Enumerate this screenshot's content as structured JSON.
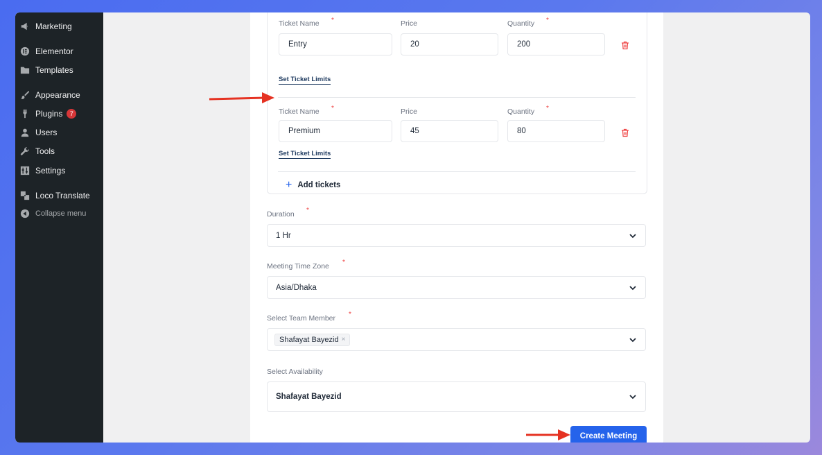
{
  "sidebar": {
    "items": [
      {
        "label": "Marketing",
        "icon": "megaphone-icon"
      },
      {
        "label": "Elementor",
        "icon": "elementor-icon"
      },
      {
        "label": "Templates",
        "icon": "folder-icon"
      },
      {
        "label": "Appearance",
        "icon": "paintbrush-icon"
      },
      {
        "label": "Plugins",
        "icon": "plugin-icon",
        "badge": "7"
      },
      {
        "label": "Users",
        "icon": "user-icon"
      },
      {
        "label": "Tools",
        "icon": "wrench-icon"
      },
      {
        "label": "Settings",
        "icon": "settings-icon"
      },
      {
        "label": "Loco Translate",
        "icon": "translate-icon"
      },
      {
        "label": "Collapse menu",
        "icon": "collapse-icon"
      }
    ]
  },
  "tickets": {
    "name_label": "Ticket Name",
    "price_label": "Price",
    "quantity_label": "Quantity",
    "required_mark": "*",
    "rows": [
      {
        "name": "Entry",
        "price": "20",
        "quantity": "200",
        "limits_link": "Set Ticket Limits"
      },
      {
        "name": "Premium",
        "price": "45",
        "quantity": "80",
        "limits_link": "Set Ticket Limits"
      }
    ],
    "add_label": "Add tickets"
  },
  "duration": {
    "label": "Duration",
    "value": "1 Hr"
  },
  "timezone": {
    "label": "Meeting Time Zone",
    "value": "Asia/Dhaka"
  },
  "team_member": {
    "label": "Select Team Member",
    "chip": "Shafayat Bayezid",
    "chip_remove": "×"
  },
  "availability": {
    "label": "Select Availability",
    "value": "Shafayat Bayezid"
  },
  "create_button": "Create Meeting",
  "colors": {
    "accent": "#2563eb",
    "required": "#ef4444",
    "annotation_arrow": "#e53222",
    "sidebar_bg": "#1d2327"
  }
}
